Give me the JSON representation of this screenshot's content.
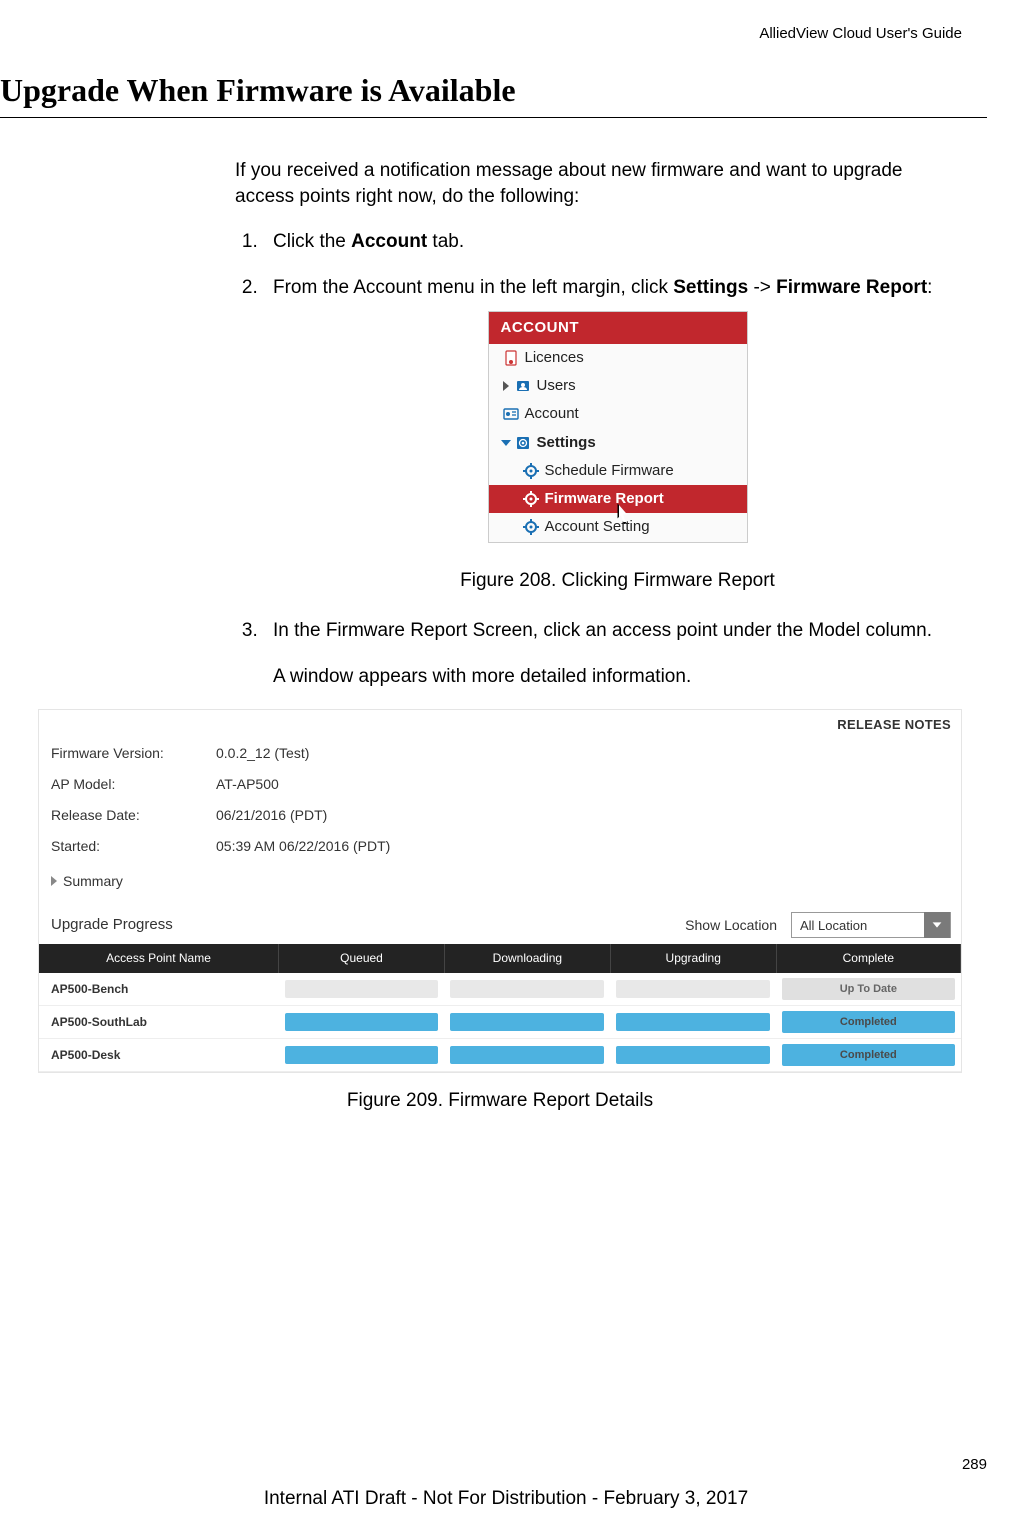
{
  "header": {
    "guide": "AlliedView Cloud User's Guide"
  },
  "title": "Upgrade When Firmware is Available",
  "intro": "If you received a notification message about new firmware and want to upgrade access points right now, do the following:",
  "steps": {
    "s1_pre": "Click the ",
    "s1_bold": "Account",
    "s1_post": " tab.",
    "s2_pre": "From the Account menu in the left margin, click ",
    "s2_b1": "Settings",
    "s2_mid": " -> ",
    "s2_b2": "Firmware Report",
    "s2_post": ":",
    "s3": "In the Firmware Report Screen, click an access point under the Model column.",
    "s3_after": "A window appears with more detailed information."
  },
  "menu": {
    "header": "ACCOUNT",
    "items": {
      "licences": "Licences",
      "users": "Users",
      "account": "Account",
      "settings": "Settings",
      "schedule": "Schedule Firmware",
      "firmware_report": "Firmware Report",
      "account_setting": "Account Setting"
    }
  },
  "fig208": "Figure 208. Clicking Firmware Report",
  "report": {
    "release_notes": "RELEASE NOTES",
    "labels": {
      "fw": "Firmware Version:",
      "model": "AP Model:",
      "release": "Release Date:",
      "started": "Started:"
    },
    "values": {
      "fw": "0.0.2_12 (Test)",
      "model": "AT-AP500",
      "release": "06/21/2016 (PDT)",
      "started": "05:39 AM 06/22/2016 (PDT)"
    },
    "summary": "Summary",
    "progress_title": "Upgrade Progress",
    "show_location": "Show Location",
    "location_value": "All Location",
    "columns": {
      "name": "Access Point Name",
      "queued": "Queued",
      "downloading": "Downloading",
      "upgrading": "Upgrading",
      "complete": "Complete"
    },
    "rows": [
      {
        "name": "AP500-Bench",
        "queued": "empty",
        "downloading": "empty",
        "upgrading": "empty",
        "status": "Up To Date",
        "status_class": "uptodate"
      },
      {
        "name": "AP500-SouthLab",
        "queued": "full",
        "downloading": "full",
        "upgrading": "full",
        "status": "Completed",
        "status_class": "completed"
      },
      {
        "name": "AP500-Desk",
        "queued": "full",
        "downloading": "full",
        "upgrading": "full",
        "status": "Completed",
        "status_class": "completed"
      }
    ]
  },
  "fig209": "Figure 209. Firmware Report Details",
  "page_number": "289",
  "footer": "Internal ATI Draft - Not For Distribution - February 3, 2017"
}
